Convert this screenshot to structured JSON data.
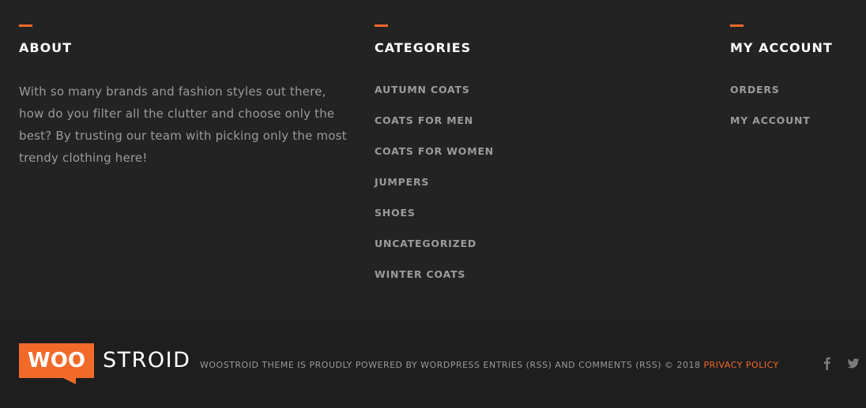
{
  "about": {
    "title": "ABOUT",
    "text": "With so many brands and fashion styles out there, how do you filter all the clutter and choose only the best? By trusting our team with picking only the most trendy clothing here!"
  },
  "categories": {
    "title": "CATEGORIES",
    "items": [
      {
        "label": "AUTUMN COATS"
      },
      {
        "label": "COATS FOR MEN"
      },
      {
        "label": "COATS FOR WOMEN"
      },
      {
        "label": "JUMPERS"
      },
      {
        "label": "SHOES"
      },
      {
        "label": "UNCATEGORIZED"
      },
      {
        "label": "WINTER COATS"
      }
    ]
  },
  "account": {
    "title": "MY ACCOUNT",
    "items": [
      {
        "label": "ORDERS"
      },
      {
        "label": "MY ACCOUNT"
      }
    ]
  },
  "footer": {
    "logo": {
      "woo": "WOO",
      "stroid": "STROID"
    },
    "credits_text": "WOOSTROID THEME IS PROUDLY POWERED BY WORDPRESS ENTRIES (RSS) AND COMMENTS (RSS) © 2018",
    "privacy_label": "PRIVACY POLICY",
    "social": {
      "facebook_icon": "facebook-icon",
      "twitter_icon": "twitter-icon"
    }
  },
  "colors": {
    "accent": "#f26a2a",
    "background_top": "#232323",
    "background_bottom": "#1e1e1e",
    "heading": "#ffffff",
    "text": "#9a9a9a"
  }
}
